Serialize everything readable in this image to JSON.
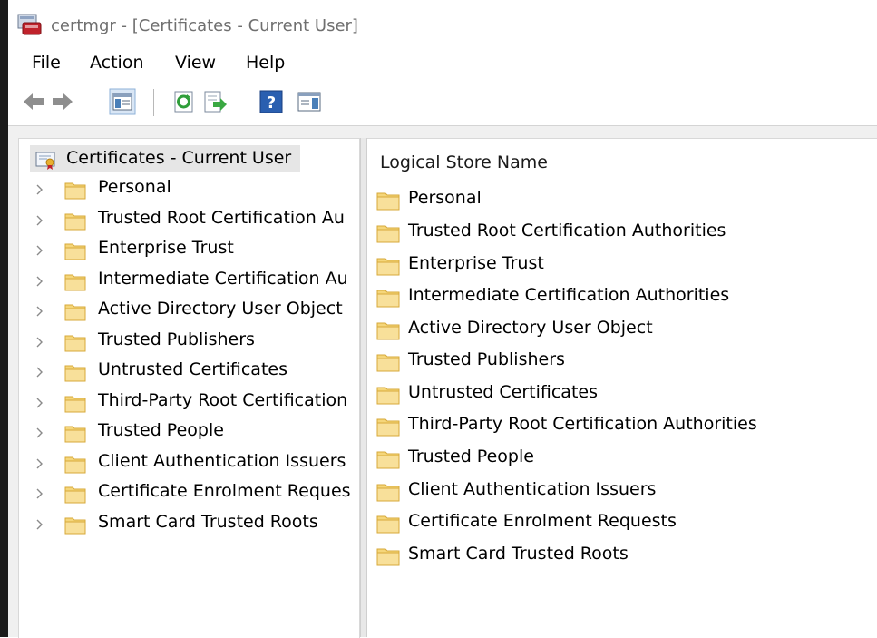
{
  "window": {
    "title": "certmgr - [Certificates - Current User]"
  },
  "menu": [
    "File",
    "Action",
    "View",
    "Help"
  ],
  "toolbar": {
    "buttons": [
      "back-icon",
      "forward-icon",
      "show-hide-console-tree-icon",
      "refresh-icon",
      "export-list-icon",
      "help-icon",
      "show-hide-action-pane-icon"
    ]
  },
  "tree": {
    "root_label": "Certificates - Current User",
    "items": [
      "Personal",
      "Trusted Root Certification Au",
      "Enterprise Trust",
      "Intermediate Certification Au",
      "Active Directory User Object",
      "Trusted Publishers",
      "Untrusted Certificates",
      "Third-Party Root Certification",
      "Trusted People",
      "Client Authentication Issuers",
      "Certificate Enrolment Reques",
      "Smart Card Trusted Roots"
    ]
  },
  "list": {
    "column_header": "Logical Store Name",
    "items": [
      "Personal",
      "Trusted Root Certification Authorities",
      "Enterprise Trust",
      "Intermediate Certification Authorities",
      "Active Directory User Object",
      "Trusted Publishers",
      "Untrusted Certificates",
      "Third-Party Root Certification Authorities",
      "Trusted People",
      "Client Authentication Issuers",
      "Certificate Enrolment Requests",
      "Smart Card Trusted Roots"
    ]
  },
  "colors": {
    "folder_fill": "#f5d67a",
    "folder_edge": "#d7a93a",
    "selection": "#e6e6e6",
    "title_text": "#6f6f6f"
  }
}
